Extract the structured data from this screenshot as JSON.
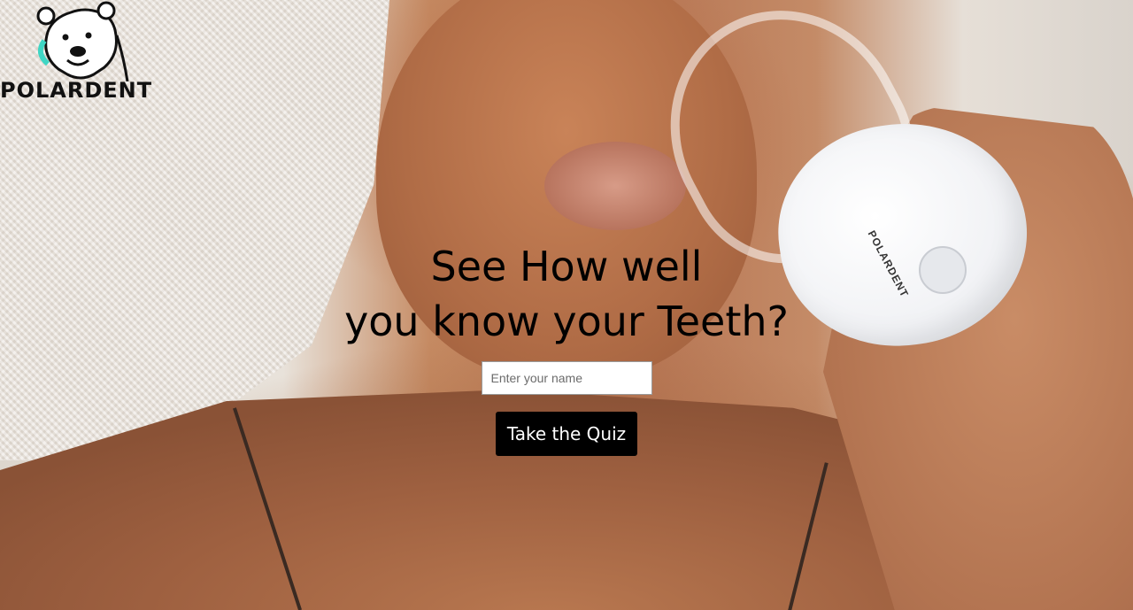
{
  "brand": {
    "name": "POLARDENT",
    "logo_icon": "polar-bear-icon",
    "device_label": "POLARDENT"
  },
  "hero": {
    "headline_line1": "See How well",
    "headline_line2": "you know your Teeth?",
    "name_input": {
      "value": "",
      "placeholder": "Enter your name"
    },
    "cta_label": "Take the Quiz"
  },
  "colors": {
    "headline": "#000000",
    "button_bg": "#000000",
    "button_text": "#ffffff",
    "logo_accent": "#3fd6c4"
  }
}
